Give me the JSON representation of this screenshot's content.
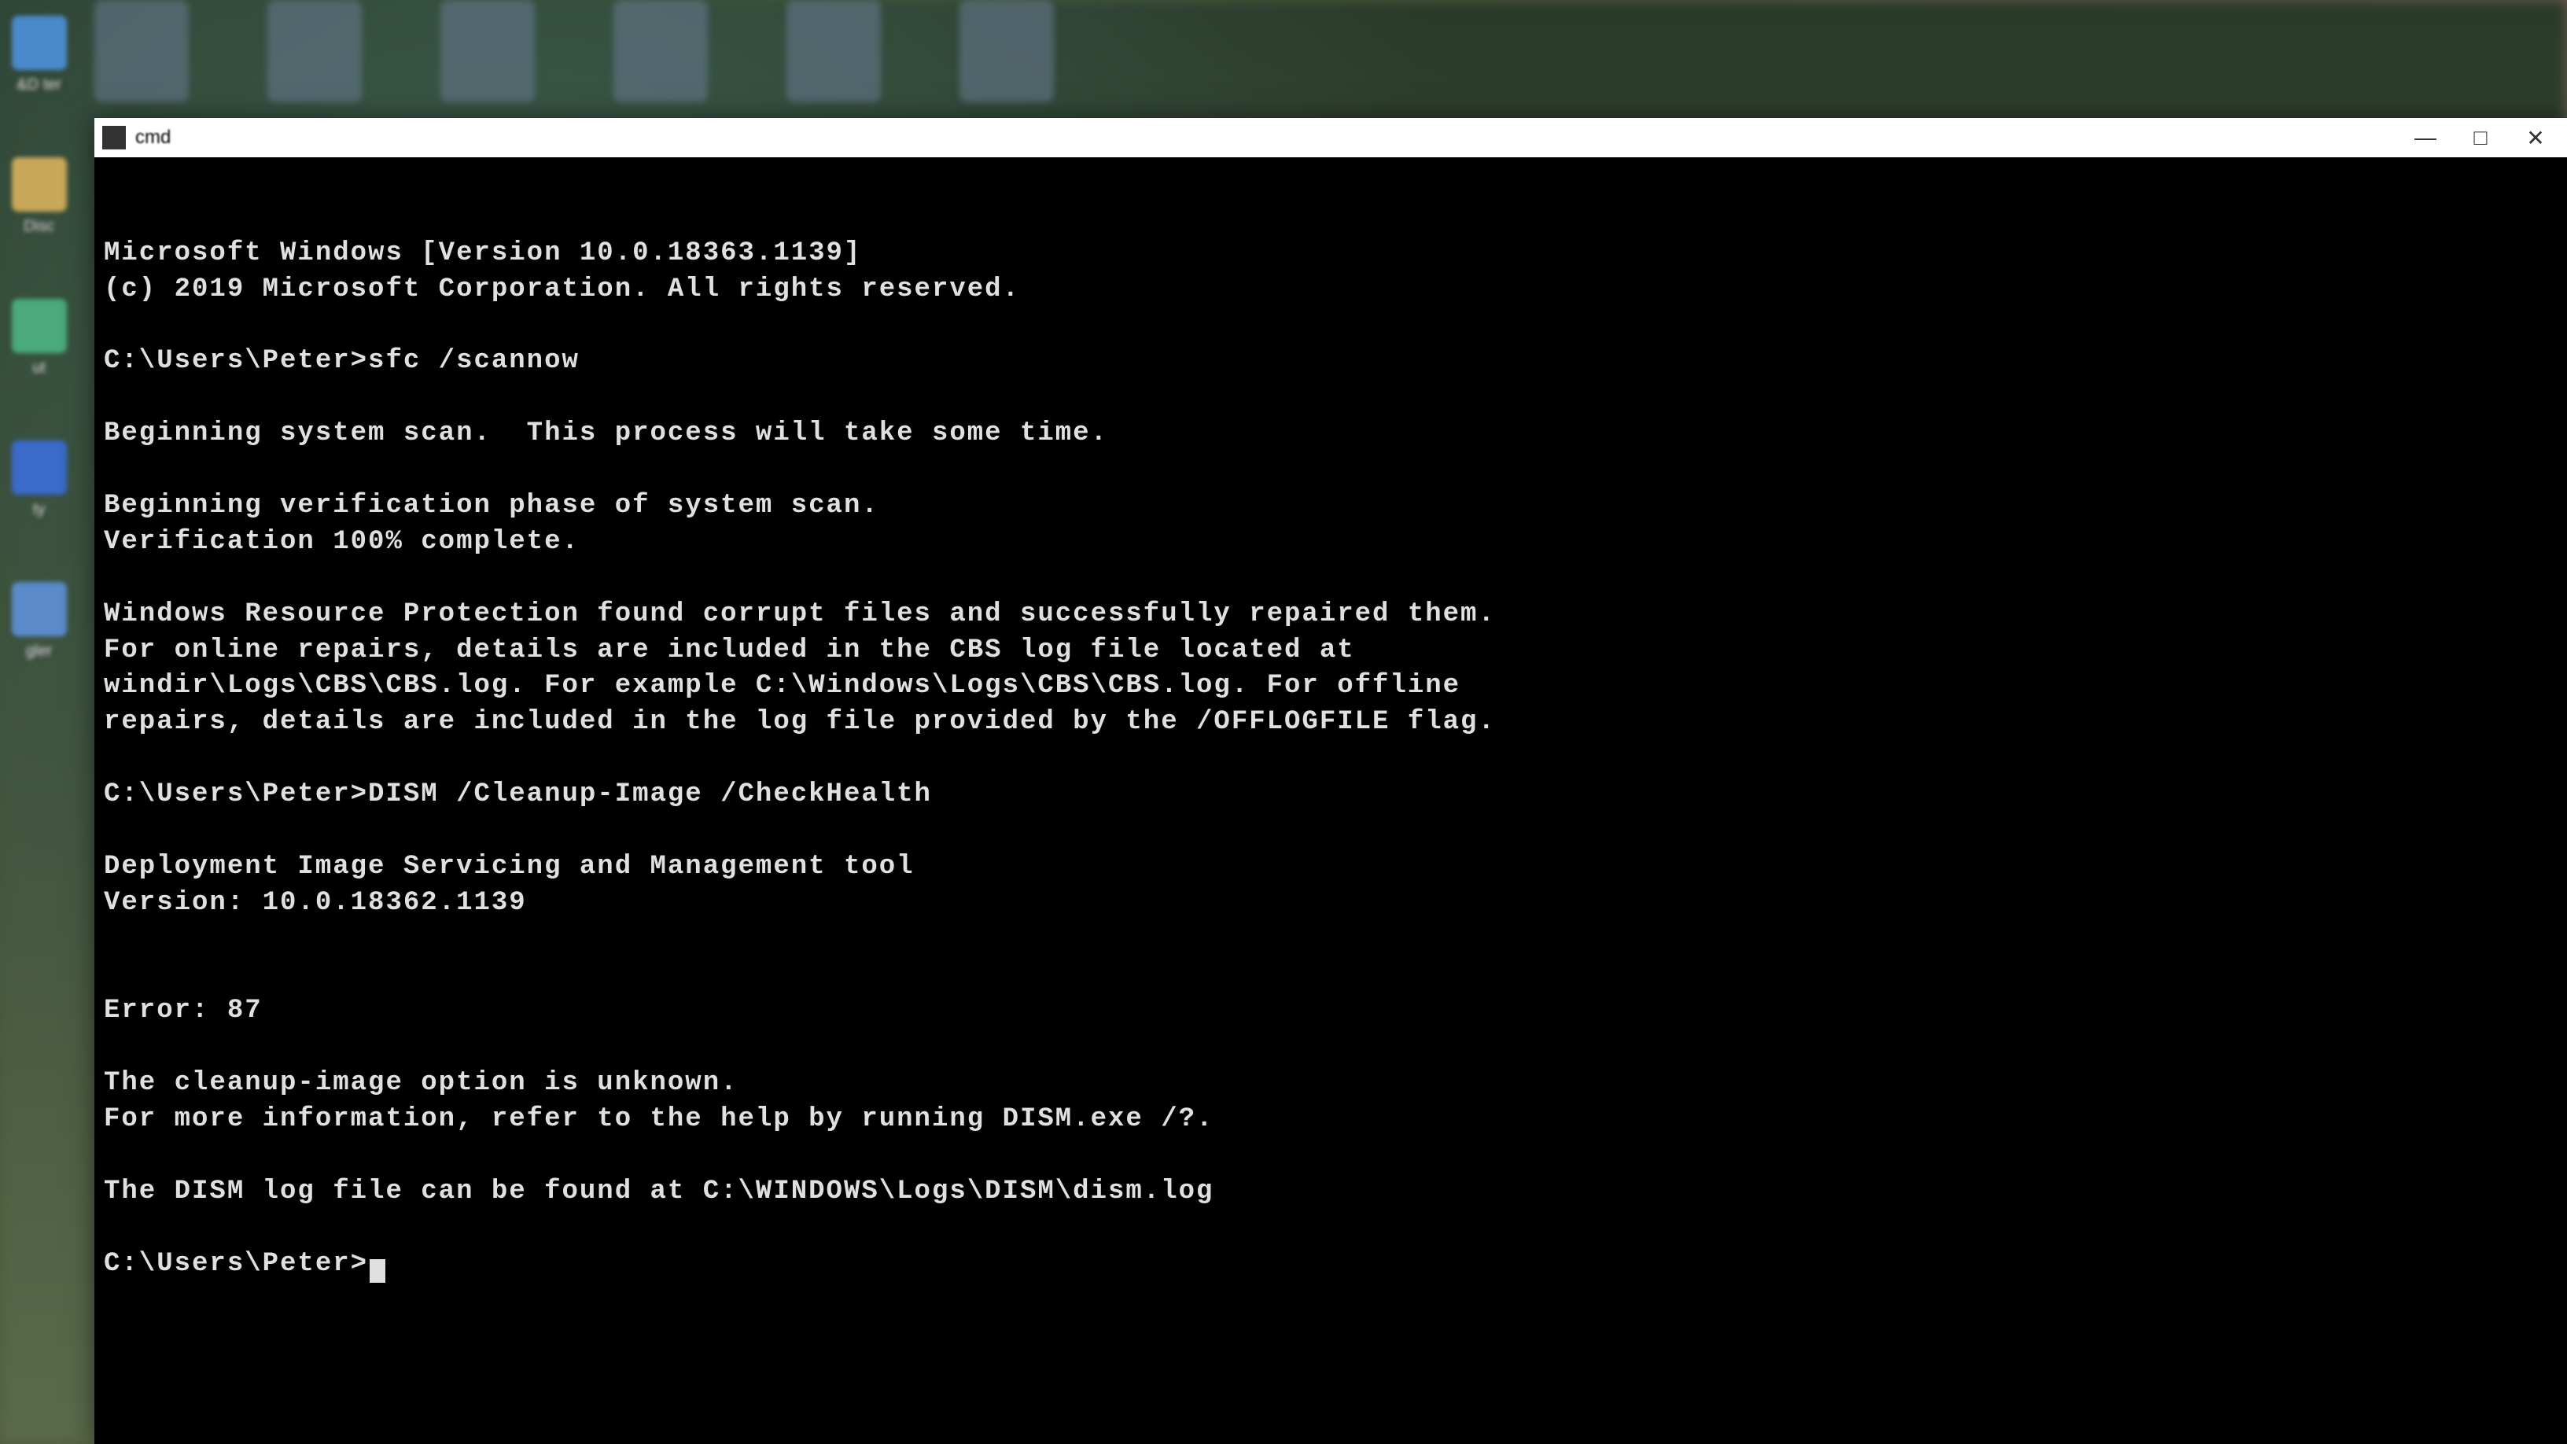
{
  "desktop": {
    "left_icons": [
      {
        "label": "&D ter"
      },
      {
        "label": "Disc"
      },
      {
        "label": "ut"
      },
      {
        "label": "ty"
      },
      {
        "label": "gler"
      }
    ]
  },
  "window": {
    "title": "cmd",
    "controls": {
      "minimize": "—",
      "maximize": "□",
      "close": "✕"
    }
  },
  "terminal": {
    "lines": [
      "Microsoft Windows [Version 10.0.18363.1139]",
      "(c) 2019 Microsoft Corporation. All rights reserved.",
      "",
      "C:\\Users\\Peter>sfc /scannow",
      "",
      "Beginning system scan.  This process will take some time.",
      "",
      "Beginning verification phase of system scan.",
      "Verification 100% complete.",
      "",
      "Windows Resource Protection found corrupt files and successfully repaired them.",
      "For online repairs, details are included in the CBS log file located at",
      "windir\\Logs\\CBS\\CBS.log. For example C:\\Windows\\Logs\\CBS\\CBS.log. For offline",
      "repairs, details are included in the log file provided by the /OFFLOGFILE flag.",
      "",
      "C:\\Users\\Peter>DISM /Cleanup-Image /CheckHealth",
      "",
      "Deployment Image Servicing and Management tool",
      "Version: 10.0.18362.1139",
      "",
      "",
      "Error: 87",
      "",
      "The cleanup-image option is unknown.",
      "For more information, refer to the help by running DISM.exe /?.",
      "",
      "The DISM log file can be found at C:\\WINDOWS\\Logs\\DISM\\dism.log",
      "",
      "C:\\Users\\Peter>"
    ]
  }
}
